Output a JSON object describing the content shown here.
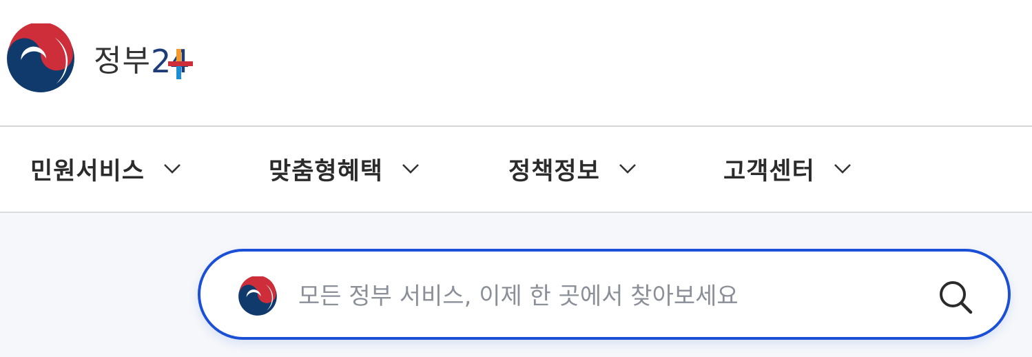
{
  "brand": {
    "name_ko": "정부",
    "name_num": "24",
    "emblem_icon": "taegeuk-emblem-icon",
    "colors": {
      "red": "#cd2e3a",
      "blue": "#0f3a6b",
      "orange": "#f39a2a",
      "light_blue": "#1b8ed6"
    }
  },
  "nav": {
    "items": [
      {
        "label": "민원서비스",
        "icon": "chevron-down-icon"
      },
      {
        "label": "맞춤형혜택",
        "icon": "chevron-down-icon"
      },
      {
        "label": "정책정보",
        "icon": "chevron-down-icon"
      },
      {
        "label": "고객센터",
        "icon": "chevron-down-icon"
      }
    ]
  },
  "search": {
    "placeholder": "모든 정부 서비스, 이제 한 곳에서 찾아보세요",
    "value": "",
    "icon": "search-icon",
    "accent": "#1a4fd6"
  }
}
